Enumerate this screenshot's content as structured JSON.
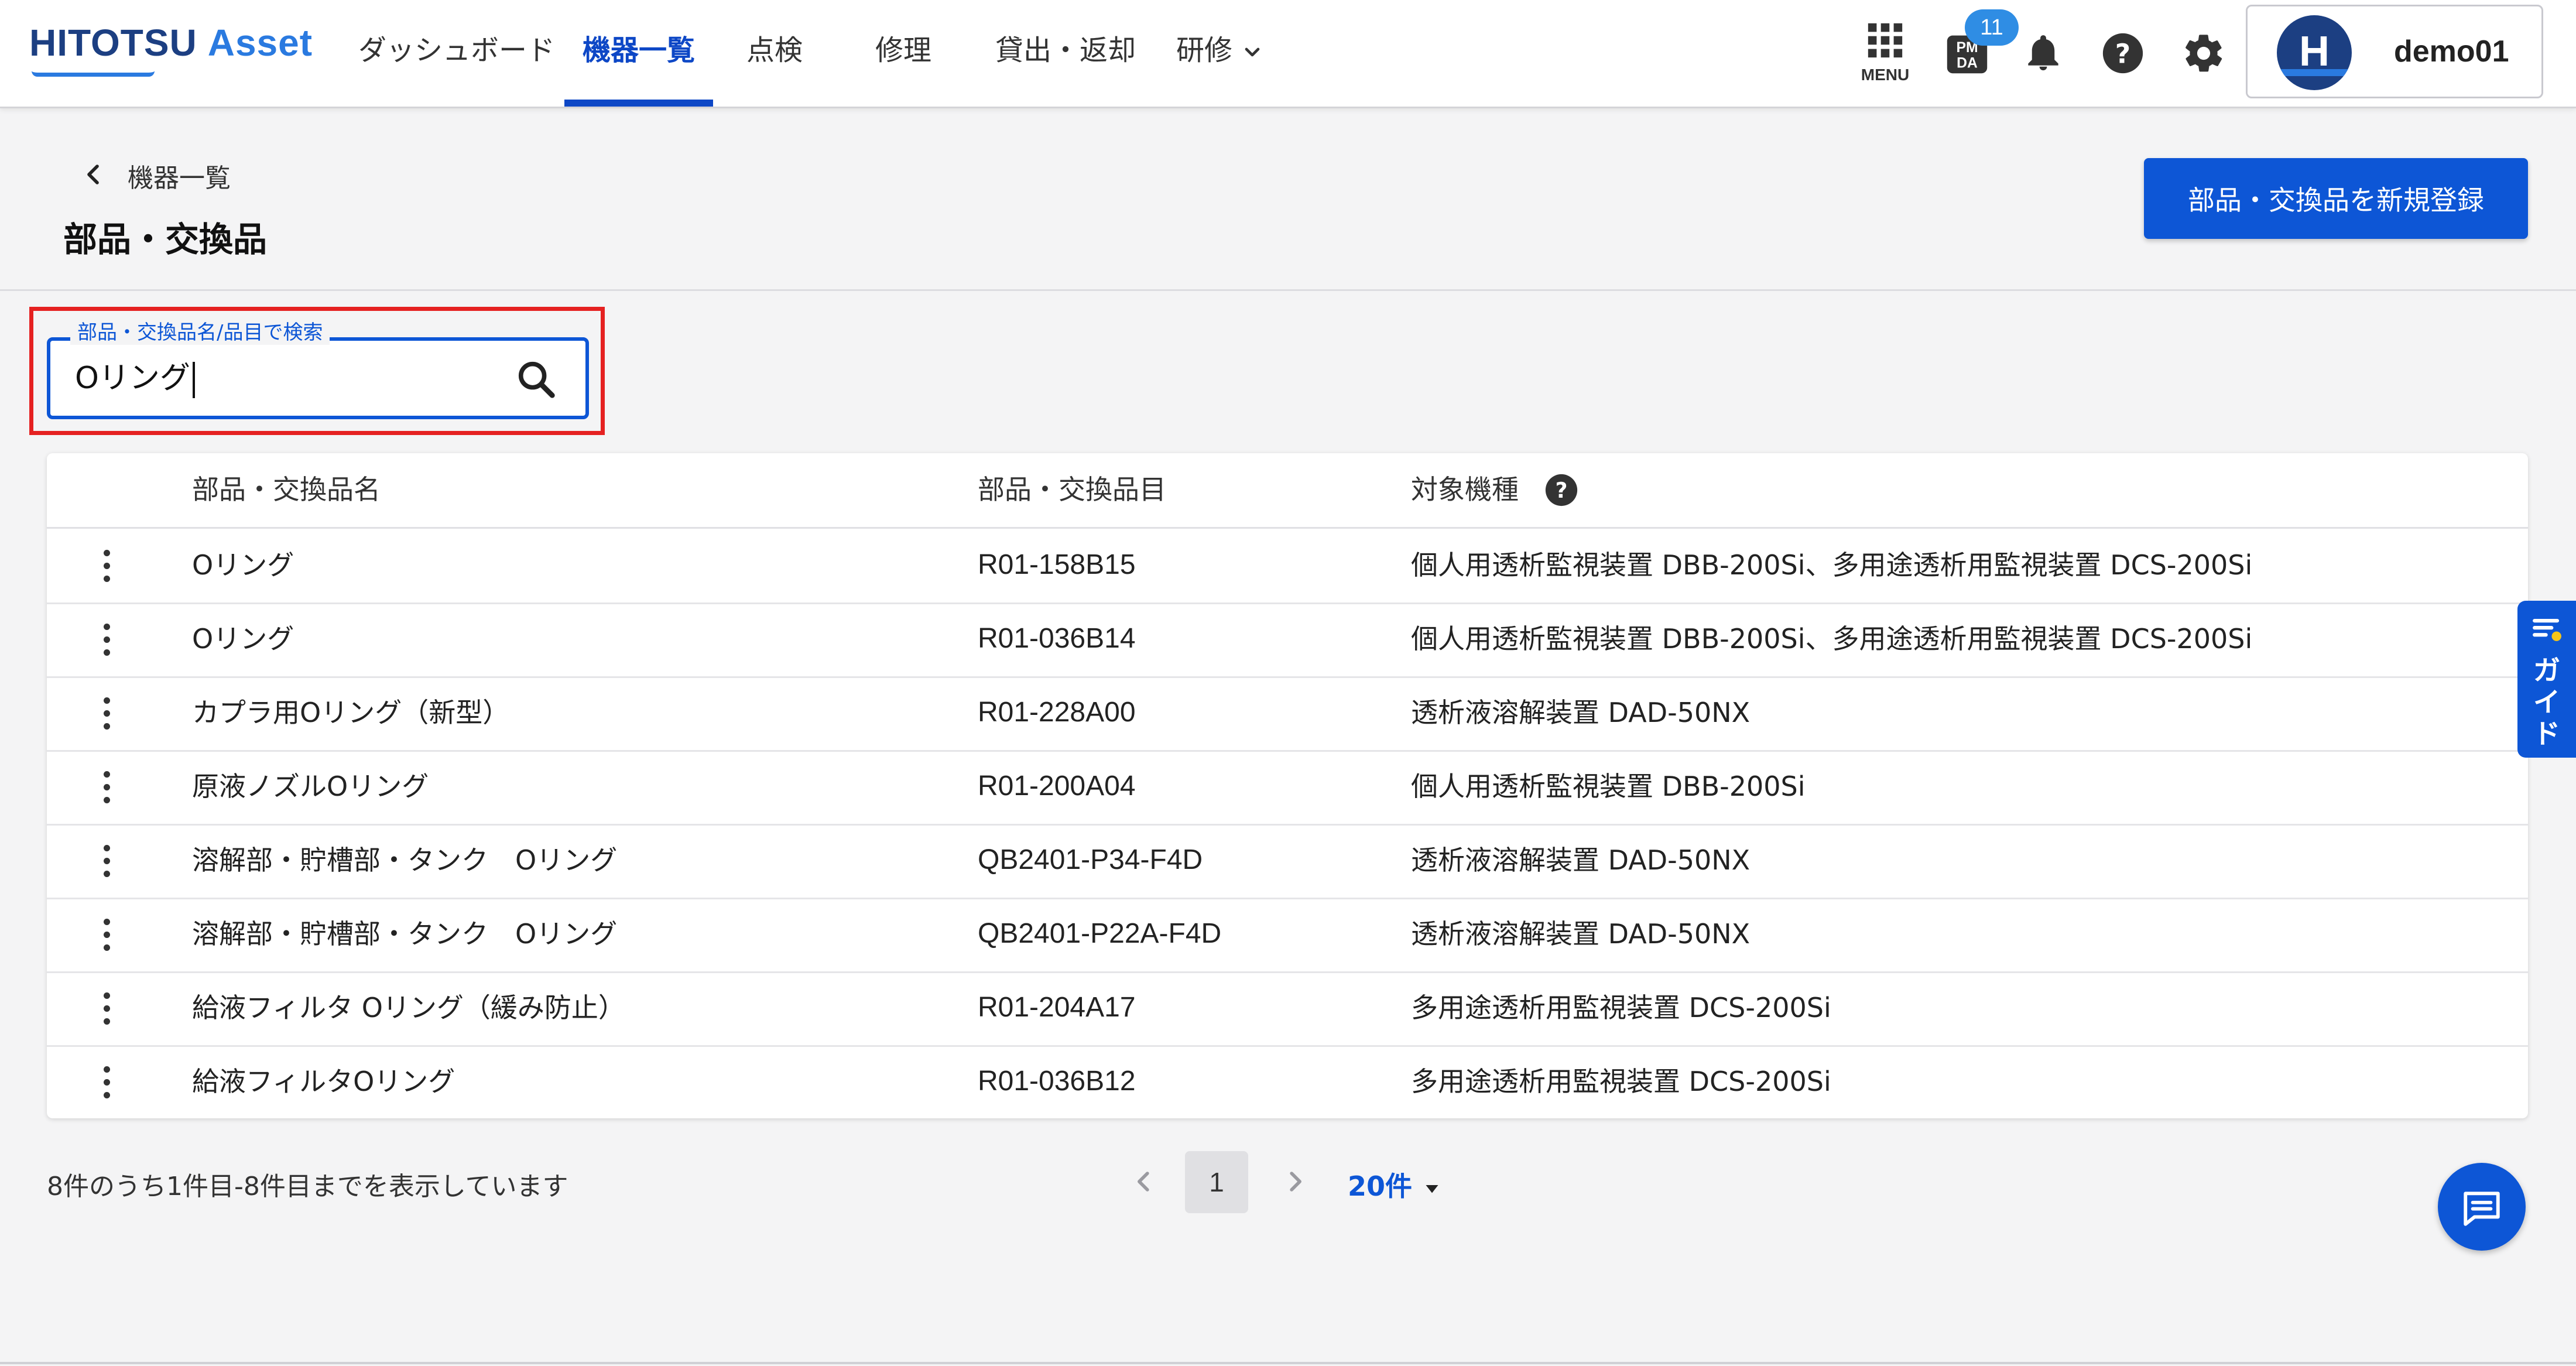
{
  "app": {
    "logo_main": "HITOTSU",
    "logo_accent": "Asset"
  },
  "nav": {
    "items": [
      {
        "label": "ダッシュボード",
        "active": false
      },
      {
        "label": "機器一覧",
        "active": true
      },
      {
        "label": "点検",
        "active": false
      },
      {
        "label": "修理",
        "active": false
      },
      {
        "label": "貸出・返却",
        "active": false
      },
      {
        "label": "研修",
        "active": false
      }
    ]
  },
  "header_icons": {
    "menu_label": "MENU",
    "pmda_label": "PMDA",
    "pmda_badge": "11"
  },
  "user": {
    "avatar_letter": "H",
    "name": "demo01"
  },
  "page": {
    "breadcrumb": "機器一覧",
    "title": "部品・交換品",
    "new_button": "部品・交換品を新規登録"
  },
  "search": {
    "label": "部品・交換品名/品目で検索",
    "value": "Oリング"
  },
  "table": {
    "headers": {
      "name": "部品・交換品名",
      "code": "部品・交換品目",
      "model": "対象機種"
    },
    "rows": [
      {
        "name": "Oリング",
        "code": "R01-158B15",
        "model": "個人用透析監視装置 DBB-200Si、多用途透析用監視装置 DCS-200Si"
      },
      {
        "name": "Oリング",
        "code": "R01-036B14",
        "model": "個人用透析監視装置 DBB-200Si、多用途透析用監視装置 DCS-200Si"
      },
      {
        "name": "カプラ用Oリング（新型）",
        "code": "R01-228A00",
        "model": "透析液溶解装置 DAD-50NX"
      },
      {
        "name": "原液ノズルOリング",
        "code": "R01-200A04",
        "model": "個人用透析監視装置 DBB-200Si"
      },
      {
        "name": "溶解部・貯槽部・タンク　Oリング",
        "code": "QB2401-P34-F4D",
        "model": "透析液溶解装置 DAD-50NX"
      },
      {
        "name": "溶解部・貯槽部・タンク　Oリング",
        "code": "QB2401-P22A-F4D",
        "model": "透析液溶解装置 DAD-50NX"
      },
      {
        "name": "給液フィルタ Oリング（緩み防止）",
        "code": "R01-204A17",
        "model": "多用途透析用監視装置 DCS-200Si"
      },
      {
        "name": "給液フィルタOリング",
        "code": "R01-036B12",
        "model": "多用途透析用監視装置 DCS-200Si"
      }
    ]
  },
  "pagination": {
    "summary": "8件のうち1件目-8件目までを表示しています",
    "current_page": "1",
    "per_page": "20件"
  },
  "floating": {
    "guide_label": "ガイド"
  },
  "colors": {
    "primary": "#0d56d6",
    "highlight": "#e52121",
    "logo_dark": "#1c3f82",
    "logo_accent": "#2a7ae0"
  }
}
